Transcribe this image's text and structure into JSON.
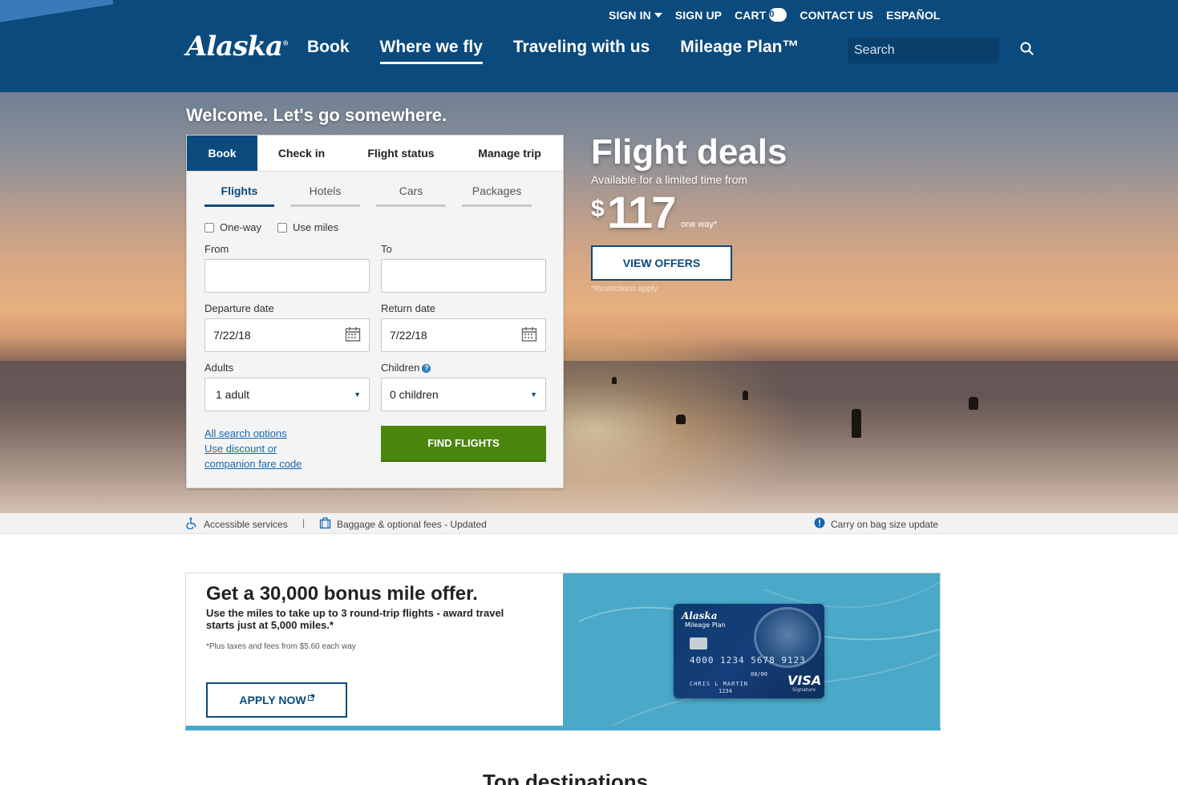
{
  "header": {
    "logo": "Alaska",
    "util_links": {
      "sign_in": "SIGN IN",
      "sign_up": "SIGN UP",
      "cart": "CART",
      "cart_count": "0",
      "contact": "CONTACT US",
      "language": "ESPAÑOL"
    },
    "nav": {
      "book": "Book",
      "where": "Where we fly",
      "traveling": "Traveling with us",
      "mileage": "Mileage Plan™"
    },
    "search_placeholder": "Search",
    "active_nav": "Where we fly"
  },
  "hero": {
    "welcome": "Welcome. Let's go somewhere."
  },
  "widget": {
    "tabs": {
      "book": "Book",
      "checkin": "Check in",
      "status": "Flight status",
      "manage": "Manage trip"
    },
    "subtabs": {
      "flights": "Flights",
      "hotels": "Hotels",
      "cars": "Cars",
      "packages": "Packages"
    },
    "options": {
      "oneway": "One-way",
      "miles": "Use miles"
    },
    "labels": {
      "from": "From",
      "to": "To",
      "depart": "Departure date",
      "return": "Return date",
      "adults": "Adults",
      "children": "Children"
    },
    "values": {
      "from": "",
      "to": "",
      "depart": "7/22/18",
      "return": "7/22/18",
      "adults": "1 adult",
      "children": "0 children"
    },
    "links": {
      "all_options": "All search options",
      "discount_1": "Use discount or",
      "discount_2": "companion fare code"
    },
    "find_button": "FIND FLIGHTS"
  },
  "deals": {
    "title": "Flight deals",
    "subtitle": "Available for a limited time from",
    "currency": "$",
    "price": "117",
    "unit": "one way*",
    "button": "VIEW OFFERS",
    "note": "*Restrictions apply"
  },
  "infobar": {
    "accessible": "Accessible services",
    "separator": "|",
    "baggage": "Baggage & optional fees - Updated",
    "carryon": "Carry on bag size update"
  },
  "promo": {
    "title": "Get a 30,000 bonus mile offer.",
    "description": "Use the miles to take up to 3 round-trip flights - award travel starts just at 5,000 miles.*",
    "fine_print": "*Plus taxes and fees from $5.60 each way",
    "button": "APPLY NOW",
    "card": {
      "logo": "Alaska",
      "program": "Mileage Plan",
      "number": "4000 1234 5678 9123",
      "expiry": "00/00",
      "name": "CHRIS L MARTIN",
      "id": "1234",
      "network": "VISA",
      "tier": "Signature"
    }
  },
  "sections": {
    "top_destinations": "Top destinations"
  },
  "colors": {
    "brand_blue": "#0b4a7d",
    "action_green": "#4b870e",
    "link_blue": "#1467b0",
    "promo_teal": "#4aa8c8"
  }
}
